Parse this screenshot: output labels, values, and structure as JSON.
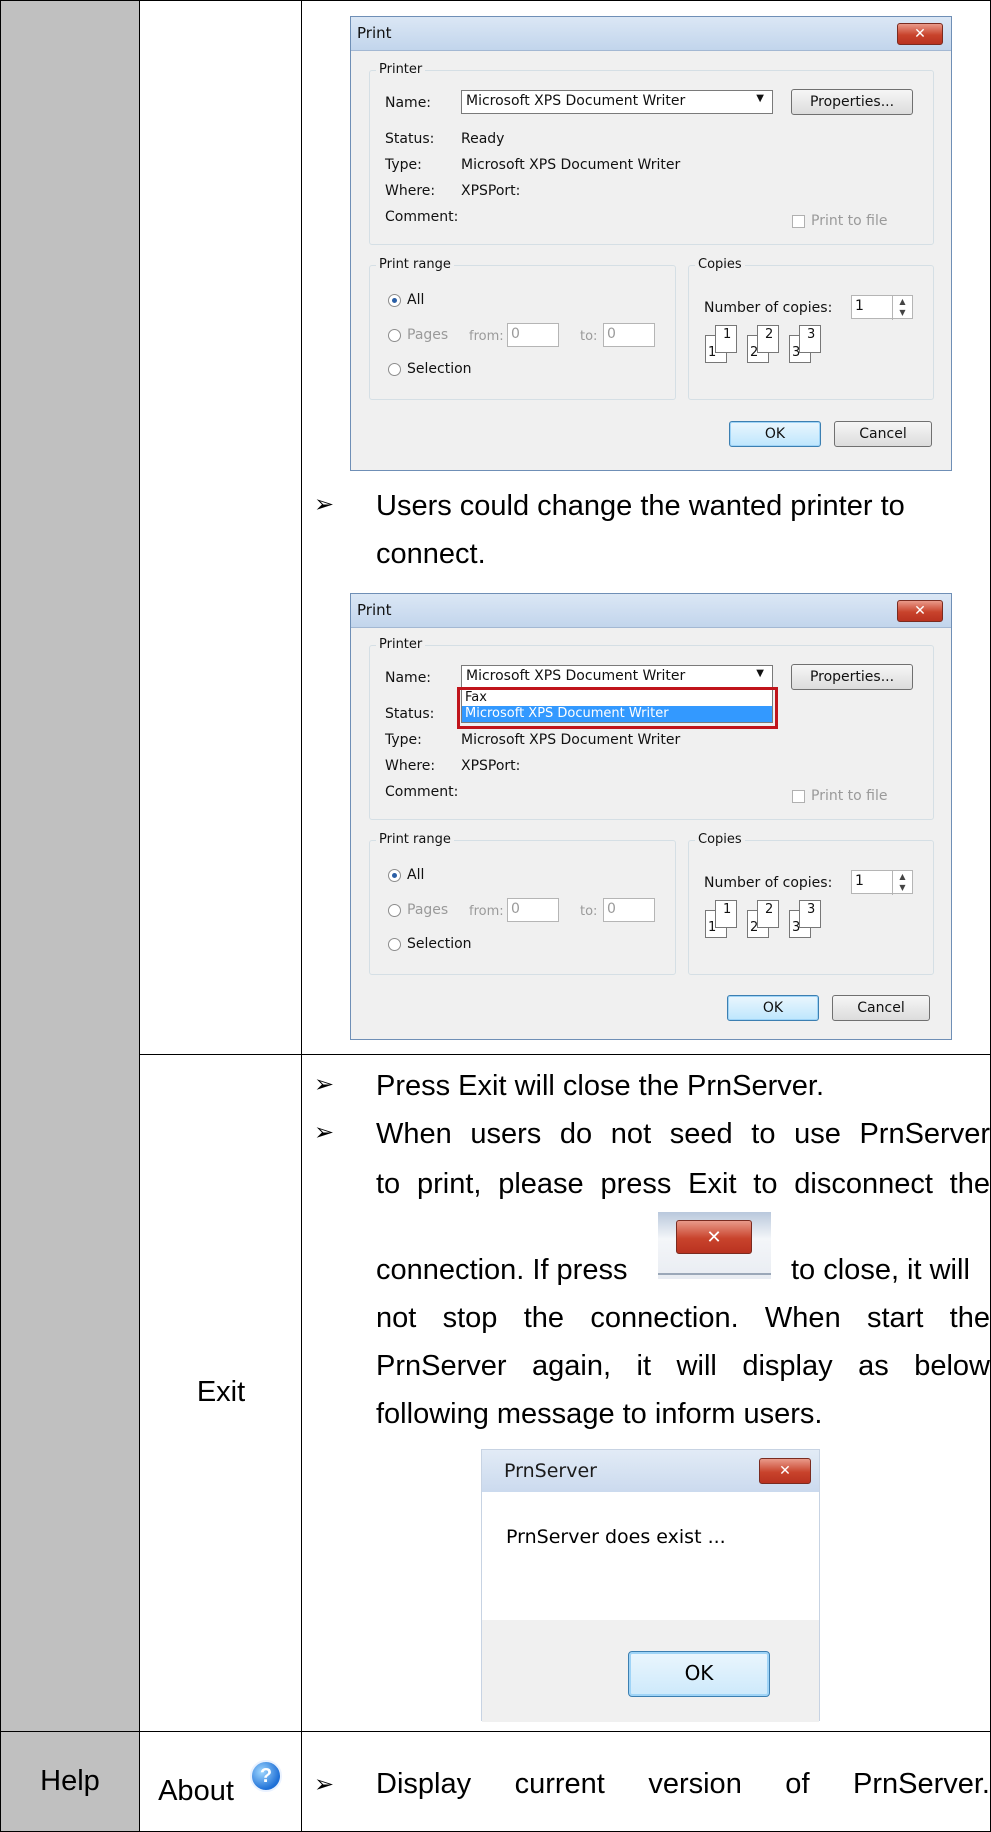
{
  "rows": {
    "exit_label": "Exit",
    "help_label": "Help",
    "about_label": "About"
  },
  "print_dialog": {
    "title": "Print",
    "close_glyph": "✕",
    "printer_group": "Printer",
    "name_label": "Name:",
    "name_value": "Microsoft XPS Document Writer",
    "properties_button": "Properties...",
    "status_label": "Status:",
    "status_value": "Ready",
    "type_label": "Type:",
    "type_value": "Microsoft XPS Document Writer",
    "where_label": "Where:",
    "where_value": "XPSPort:",
    "comment_label": "Comment:",
    "print_to_file": "Print to file",
    "print_range_group": "Print range",
    "all_label": "All",
    "pages_label": "Pages",
    "from_label": "from:",
    "from_value": "0",
    "to_label": "to:",
    "to_value": "0",
    "selection_label": "Selection",
    "copies_group": "Copies",
    "copies_label": "Number of copies:",
    "copies_value": "1",
    "collate_pages": [
      "1",
      "1",
      "2",
      "2",
      "3",
      "3"
    ],
    "ok_button": "OK",
    "cancel_button": "Cancel",
    "printer_options": [
      "Fax",
      "Microsoft XPS Document Writer"
    ]
  },
  "text": {
    "bullet_glyph": "➢",
    "change_printer": "Users could change the wanted printer to",
    "change_printer_2": "connect.",
    "exit_1": "Press Exit will close the PrnServer.",
    "exit_2a": "When users do not seed to use PrnServer",
    "exit_2b": "to print, please press Exit to disconnect the",
    "exit_2c": "connection. If press",
    "exit_2d": "to close, it will",
    "exit_2e": "not stop the connection. When start the",
    "exit_2f": "PrnServer again, it will display as below",
    "exit_2g": "following message to inform users.",
    "help_1": "Display current version of PrnServer."
  },
  "message_box": {
    "title": "PrnServer",
    "close_glyph": "✕",
    "message": "PrnServer does exist ...",
    "ok_button": "OK"
  },
  "about_icon_glyph": "?"
}
